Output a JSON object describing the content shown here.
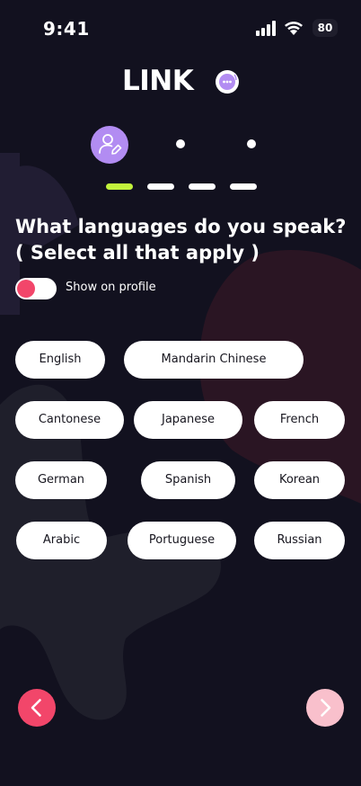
{
  "status_bar": {
    "time": "9:41",
    "battery": "80",
    "icons": [
      "cellular-signal-icon",
      "wifi-icon",
      "battery-icon"
    ]
  },
  "app": {
    "logo_text": "LINK",
    "logo_badge_icon": "chat-bubble-icon"
  },
  "steps": {
    "current_step_icon": "user-edit-icon",
    "total_steps": 3,
    "current_step": 1,
    "progress_segments": 4,
    "progress_active": 1
  },
  "question": {
    "line1": "What languages do you speak?",
    "line2": "( Select all that apply )"
  },
  "profile_toggle": {
    "label": "Show on profile",
    "state": "on"
  },
  "languages": [
    "English",
    "Mandarin Chinese",
    "Cantonese",
    "Japanese",
    "French",
    "German",
    "Spanish",
    "Korean",
    "Arabic",
    "Portuguese",
    "Russian"
  ],
  "navigation": {
    "prev_icon": "chevron-left-icon",
    "next_icon": "chevron-right-icon"
  },
  "colors": {
    "background": "#12111f",
    "accent_pink": "#f2466a",
    "accent_pink_light": "#f9c0cc",
    "accent_lime": "#c2f23c",
    "accent_purple": "#b28cf2",
    "chip_bg": "#ffffff",
    "chip_text": "#17161f"
  }
}
